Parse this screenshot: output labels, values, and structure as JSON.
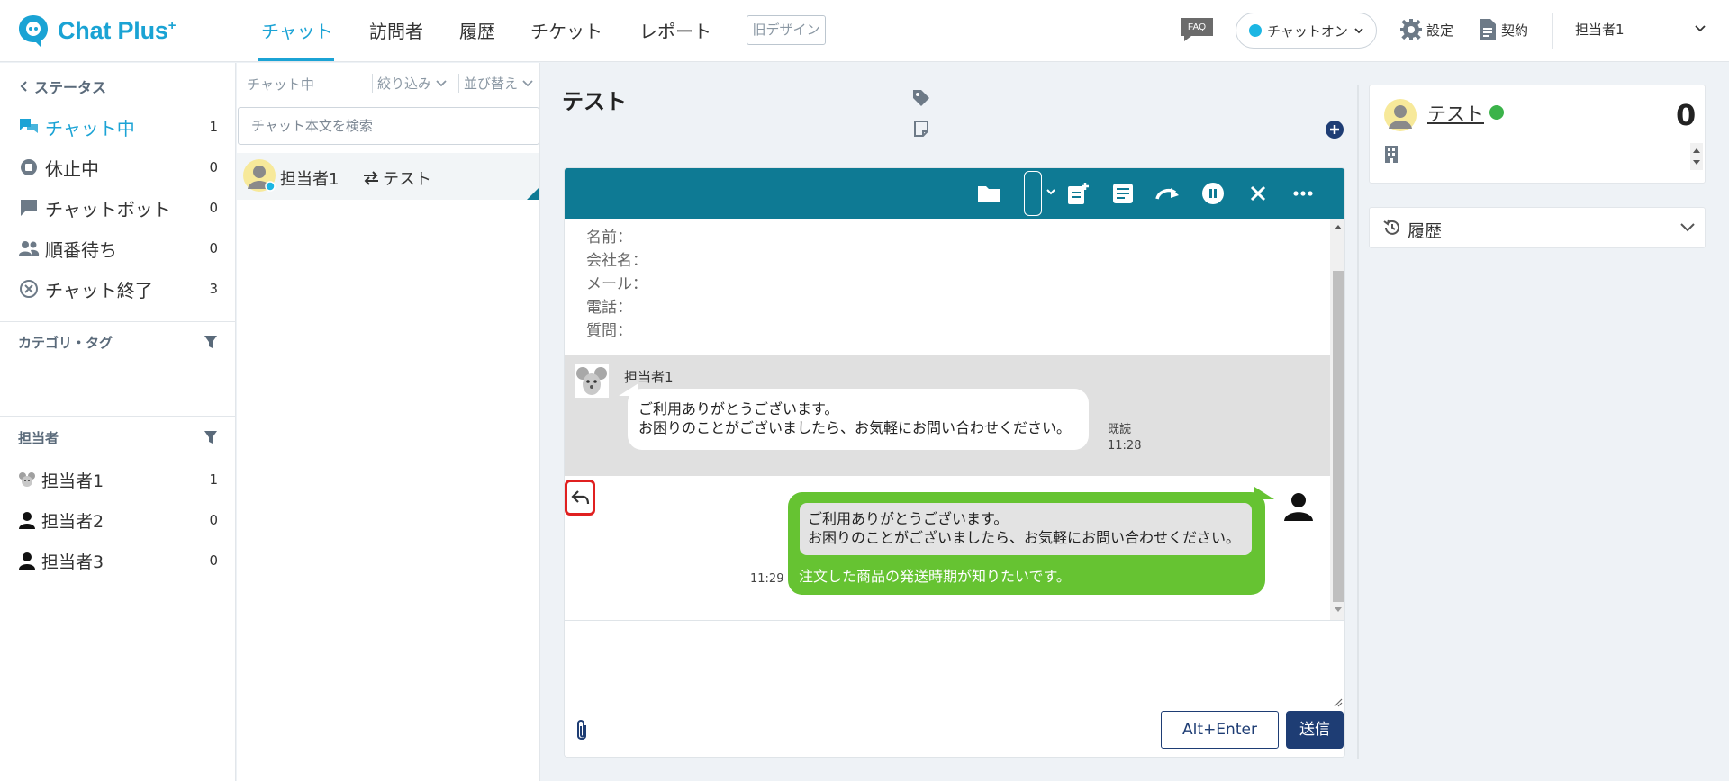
{
  "app": {
    "logo_text": "Chat Plus",
    "logo_plus": "+"
  },
  "nav": {
    "tabs": [
      {
        "label": "チャット"
      },
      {
        "label": "訪問者"
      },
      {
        "label": "履歴"
      },
      {
        "label": "チケット"
      },
      {
        "label": "レポート"
      }
    ],
    "old_design": "旧デザイン",
    "faq": "FAQ",
    "chat_toggle": "チャットオン",
    "settings": "設定",
    "contract": "契約",
    "user": "担当者1"
  },
  "sidebar": {
    "status_title": "ステータス",
    "items": [
      {
        "label": "チャット中",
        "count": "1"
      },
      {
        "label": "休止中",
        "count": "0"
      },
      {
        "label": "チャットボット",
        "count": "0"
      },
      {
        "label": "順番待ち",
        "count": "0"
      },
      {
        "label": "チャット終了",
        "count": "3"
      }
    ],
    "category_title": "カテゴリ・タグ",
    "agents_title": "担当者",
    "agents": [
      {
        "label": "担当者1",
        "count": "1"
      },
      {
        "label": "担当者2",
        "count": "0"
      },
      {
        "label": "担当者3",
        "count": "0"
      }
    ]
  },
  "chatlist": {
    "title": "チャット中",
    "filter": "絞り込み",
    "sort": "並び替え",
    "search_placeholder": "チャット本文を検索",
    "rows": [
      {
        "agent": "担当者1",
        "visitor": "テスト"
      }
    ]
  },
  "chat": {
    "title": "テスト",
    "form": [
      "名前：",
      "会社名：",
      "メール：",
      "電話：",
      "質問："
    ],
    "agent_name": "担当者1",
    "agent_message_line1": "ご利用ありがとうございます。",
    "agent_message_line2": "お困りのことがございましたら、お気軽にお問い合わせください。",
    "agent_read": "既読",
    "agent_time": "11:28",
    "quote_line1": "ご利用ありがとうございます。",
    "quote_line2": "お困りのことがございましたら、お気軽にお問い合わせください。",
    "visitor_message": "注文した商品の発送時期が知りたいです。",
    "visitor_time": "11:29",
    "alt_enter": "Alt+Enter",
    "send": "送信"
  },
  "visitor_panel": {
    "name": "テスト",
    "score": "0",
    "history": "履歴"
  },
  "colors": {
    "accent": "#1ba3d5",
    "toolbar": "#0e7a94",
    "visitor_bubble": "#66c332",
    "send_button": "#1e3d74"
  }
}
